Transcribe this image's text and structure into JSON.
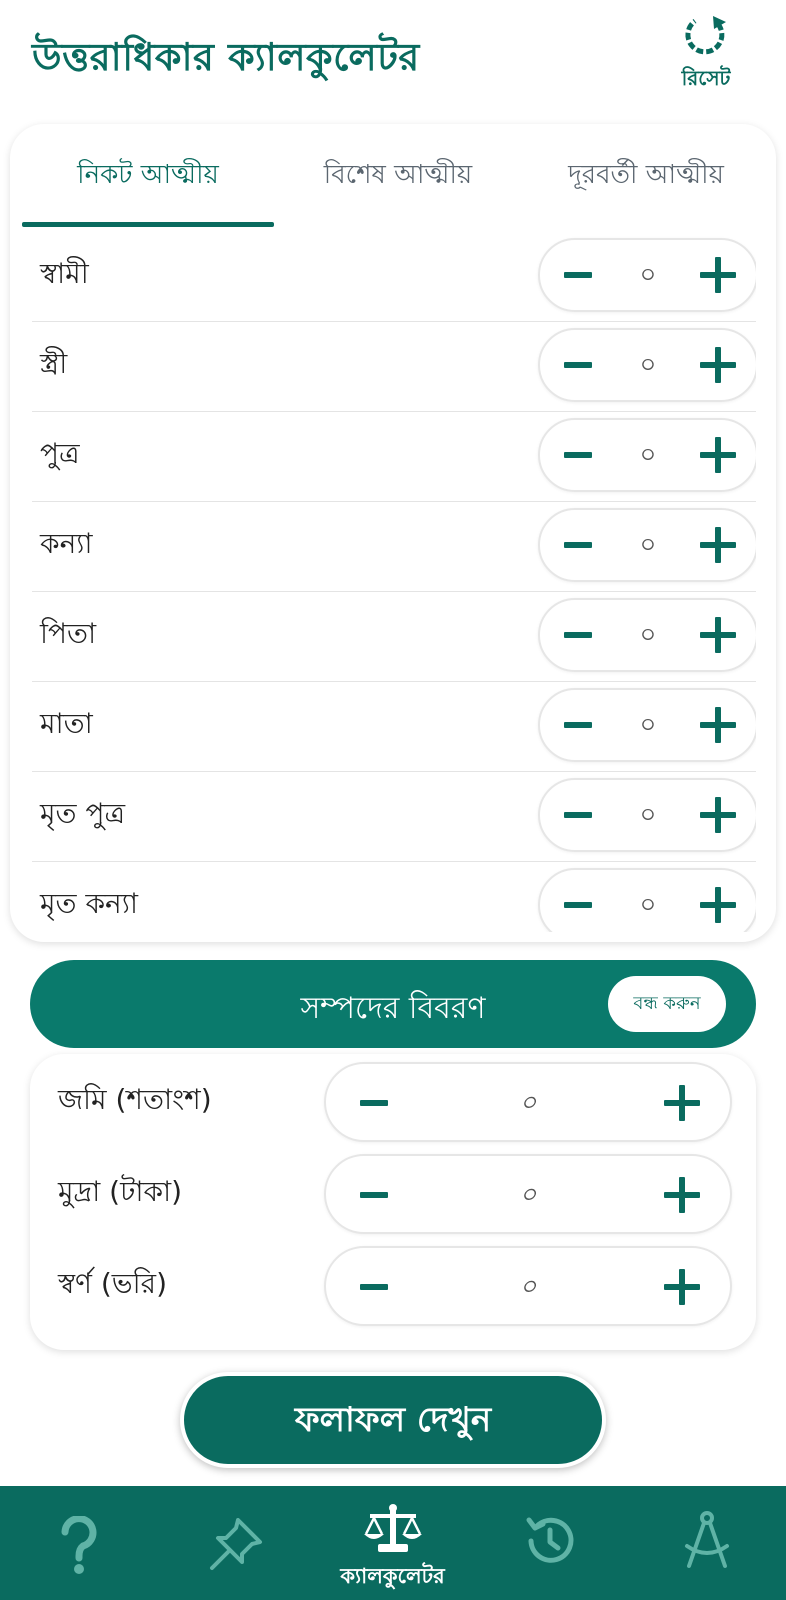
{
  "header": {
    "title": "উত্তরাধিকার ক্যালকুলেটর",
    "reset_label": "রিসেট"
  },
  "tabs": [
    {
      "label": "নিকট আত্মীয়",
      "active": true
    },
    {
      "label": "বিশেষ আত্মীয়",
      "active": false
    },
    {
      "label": "দূরবর্তী আত্মীয়",
      "active": false
    }
  ],
  "relatives": [
    {
      "label": "স্বামী",
      "value": "০"
    },
    {
      "label": "স্ত্রী",
      "value": "০"
    },
    {
      "label": "পুত্র",
      "value": "০"
    },
    {
      "label": "কন্যা",
      "value": "০"
    },
    {
      "label": "পিতা",
      "value": "০"
    },
    {
      "label": "মাতা",
      "value": "০"
    },
    {
      "label": "মৃত পুত্র",
      "value": "০"
    },
    {
      "label": "মৃত কন্যা",
      "value": "০"
    }
  ],
  "property": {
    "title": "সম্পদের বিবরণ",
    "close_label": "বন্ধ করুন",
    "items": [
      {
        "label": "জমি (শতাংশ)",
        "value": "০"
      },
      {
        "label": "মুদ্রা (টাকা)",
        "value": "০"
      },
      {
        "label": "স্বর্ণ (ভরি)",
        "value": "০"
      }
    ]
  },
  "result_button": "ফলাফল দেখুন",
  "bottom_nav": {
    "active_label": "ক্যালকুলেটর",
    "items": [
      "help-icon",
      "pin-icon",
      "scale-icon",
      "history-icon",
      "compass-icon"
    ]
  },
  "colors": {
    "primary": "#0a6b5f",
    "primary_light": "#0a7a6c",
    "inactive_tab": "#5b6670"
  }
}
